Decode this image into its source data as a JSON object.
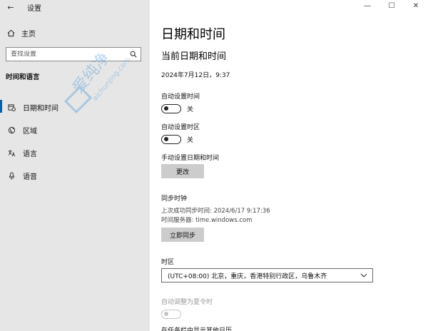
{
  "window": {
    "title": "设置",
    "back": "←",
    "minimize": "—",
    "maximize": "☐",
    "close": "✕"
  },
  "sidebar": {
    "home_label": "主页",
    "search_placeholder": "查找设置",
    "section_title": "时间和语言",
    "items": [
      {
        "label": "日期和时间",
        "icon": "calendar-clock-icon",
        "active": true
      },
      {
        "label": "区域",
        "icon": "globe-icon",
        "active": false
      },
      {
        "label": "语言",
        "icon": "language-icon",
        "active": false
      },
      {
        "label": "语音",
        "icon": "microphone-icon",
        "active": false
      }
    ]
  },
  "main": {
    "title": "日期和时间",
    "subtitle": "当前日期和时间",
    "current_datetime": "2024年7月12日，9:37",
    "auto_time": {
      "label": "自动设置时间",
      "state_label": "关"
    },
    "auto_timezone": {
      "label": "自动设置时区",
      "state_label": "关"
    },
    "manual": {
      "label": "手动设置日期和时间",
      "button": "更改"
    },
    "sync": {
      "label": "同步时钟",
      "last_sync": "上次成功同步时间: 2024/6/17 9:17:36",
      "server": "时间服务器: time.windows.com",
      "button": "立即同步"
    },
    "timezone": {
      "label": "时区",
      "selected": "(UTC+08:00) 北京，重庆，香港特别行政区，乌鲁木齐"
    },
    "dst": {
      "label": "自动调整为夏令时"
    },
    "cut_off_text": "在任务栏中显示其他日历"
  },
  "watermark": {
    "text": "爱纯净",
    "url": "aichunjing.com"
  },
  "colors": {
    "sidebar_bg": "#e6e6e6",
    "accent": "#0063b1",
    "button_bg": "#cccccc"
  }
}
